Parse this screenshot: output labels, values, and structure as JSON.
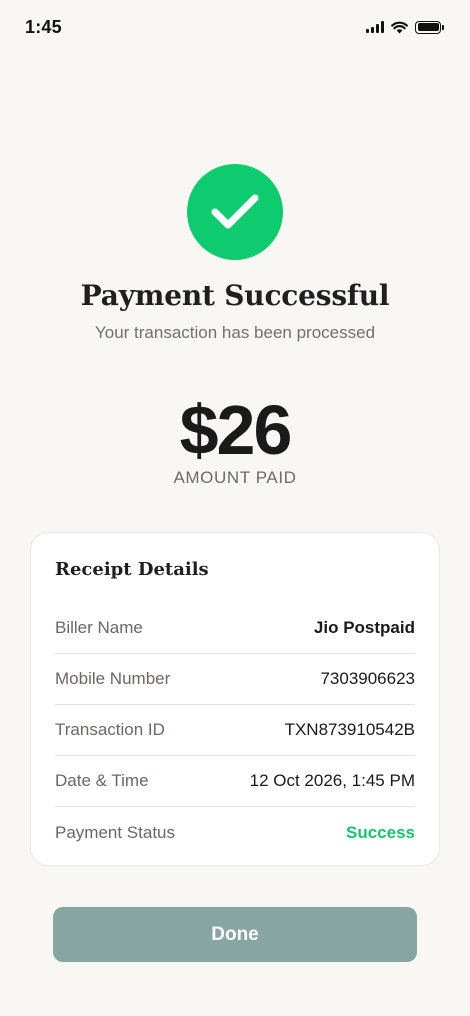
{
  "status_bar": {
    "time": "1:45",
    "icons": [
      "signal-icon",
      "wifi-icon",
      "battery-icon"
    ]
  },
  "success": {
    "icon": "checkmark-icon",
    "icon_color": "#0ecb6f",
    "title": "Payment Successful",
    "subtitle": "Your transaction has been processed"
  },
  "amount": {
    "value": "$26",
    "label": "AMOUNT PAID"
  },
  "receipt": {
    "title": "Receipt Details",
    "rows": [
      {
        "label": "Biller Name",
        "value": "Jio Postpaid"
      },
      {
        "label": "Mobile Number",
        "value": "7303906623"
      },
      {
        "label": "Transaction ID",
        "value": "TXN873910542B"
      },
      {
        "label": "Date & Time",
        "value": "12 Oct 2026, 1:45 PM"
      },
      {
        "label": "Payment Status",
        "value": "Success",
        "status_color": "#17c36a"
      }
    ]
  },
  "actions": {
    "done_label": "Done",
    "done_color": "#87a5a2"
  }
}
